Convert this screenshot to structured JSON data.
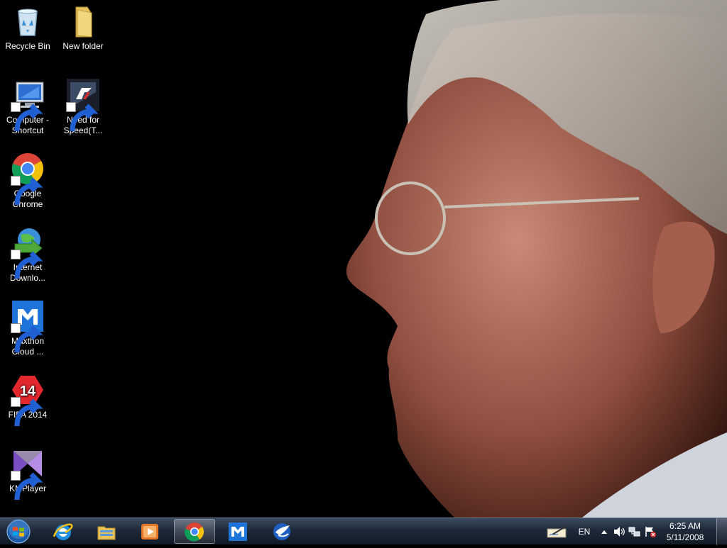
{
  "desktop": {
    "icons": [
      {
        "label": "Recycle Bin",
        "icon": "recycle-bin-icon"
      },
      {
        "label": "New folder",
        "icon": "folder-icon"
      },
      {
        "label": "Computer - Shortcut",
        "icon": "computer-icon"
      },
      {
        "label": "Need for Speed(T...",
        "icon": "need-for-speed-icon"
      },
      {
        "label": "Google Chrome",
        "icon": "chrome-icon"
      },
      {
        "label": "Internet Downlo...",
        "icon": "internet-download-manager-icon"
      },
      {
        "label": "Maxthon Cloud ...",
        "icon": "maxthon-icon"
      },
      {
        "label": "FIFA 2014",
        "icon": "fifa-2014-icon"
      },
      {
        "label": "KMPlayer",
        "icon": "kmplayer-icon"
      }
    ]
  },
  "taskbar": {
    "pinned": [
      {
        "name": "internet-explorer",
        "icon": "internet-explorer-icon"
      },
      {
        "name": "windows-explorer",
        "icon": "windows-explorer-icon"
      },
      {
        "name": "media-player",
        "icon": "media-player-icon"
      },
      {
        "name": "google-chrome",
        "icon": "chrome-icon",
        "active": true
      },
      {
        "name": "maxthon",
        "icon": "maxthon-icon"
      },
      {
        "name": "ccleaner",
        "icon": "bird-app-icon"
      }
    ],
    "tray": {
      "language": "EN",
      "time": "6:25 AM",
      "date": "5/11/2008"
    }
  },
  "colors": {
    "taskbar_top": "#3b4a5e",
    "taskbar_bottom": "#111a26",
    "desktop_bg": "#000000"
  }
}
